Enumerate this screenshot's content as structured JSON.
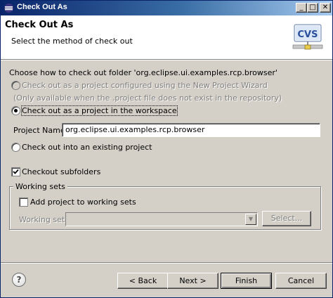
{
  "window": {
    "title": "Check Out As",
    "minimize": "_",
    "maximize": "□",
    "close": "✕"
  },
  "header": {
    "title": "Check Out As",
    "description": "Select the method of check out",
    "logo_text": "CVS"
  },
  "body": {
    "prompt": "Choose how to check out folder 'org.eclipse.ui.examples.rcp.browser'",
    "options": [
      {
        "label": "Check out as a project configured using the New Project Wizard",
        "selected": false,
        "enabled": false
      },
      {
        "label": "Check out as a project in the workspace",
        "selected": true,
        "enabled": true
      },
      {
        "label": "Check out into an existing project",
        "selected": false,
        "enabled": true
      }
    ],
    "option_note": "(Only available when the .project file does not exist in the repository)",
    "project_name_label": "Project Name:",
    "project_name_value": "org.eclipse.ui.examples.rcp.browser",
    "checkout_subfolders": {
      "label": "Checkout subfolders",
      "checked": true
    }
  },
  "working_sets": {
    "group_title": "Working sets",
    "add_label": "Add project to working sets",
    "add_checked": false,
    "sets_label": "Working sets:",
    "sets_value": "",
    "select_button": "Select..."
  },
  "footer": {
    "help": "?",
    "back": "< Back",
    "next": "Next >",
    "finish": "Finish",
    "cancel": "Cancel"
  }
}
